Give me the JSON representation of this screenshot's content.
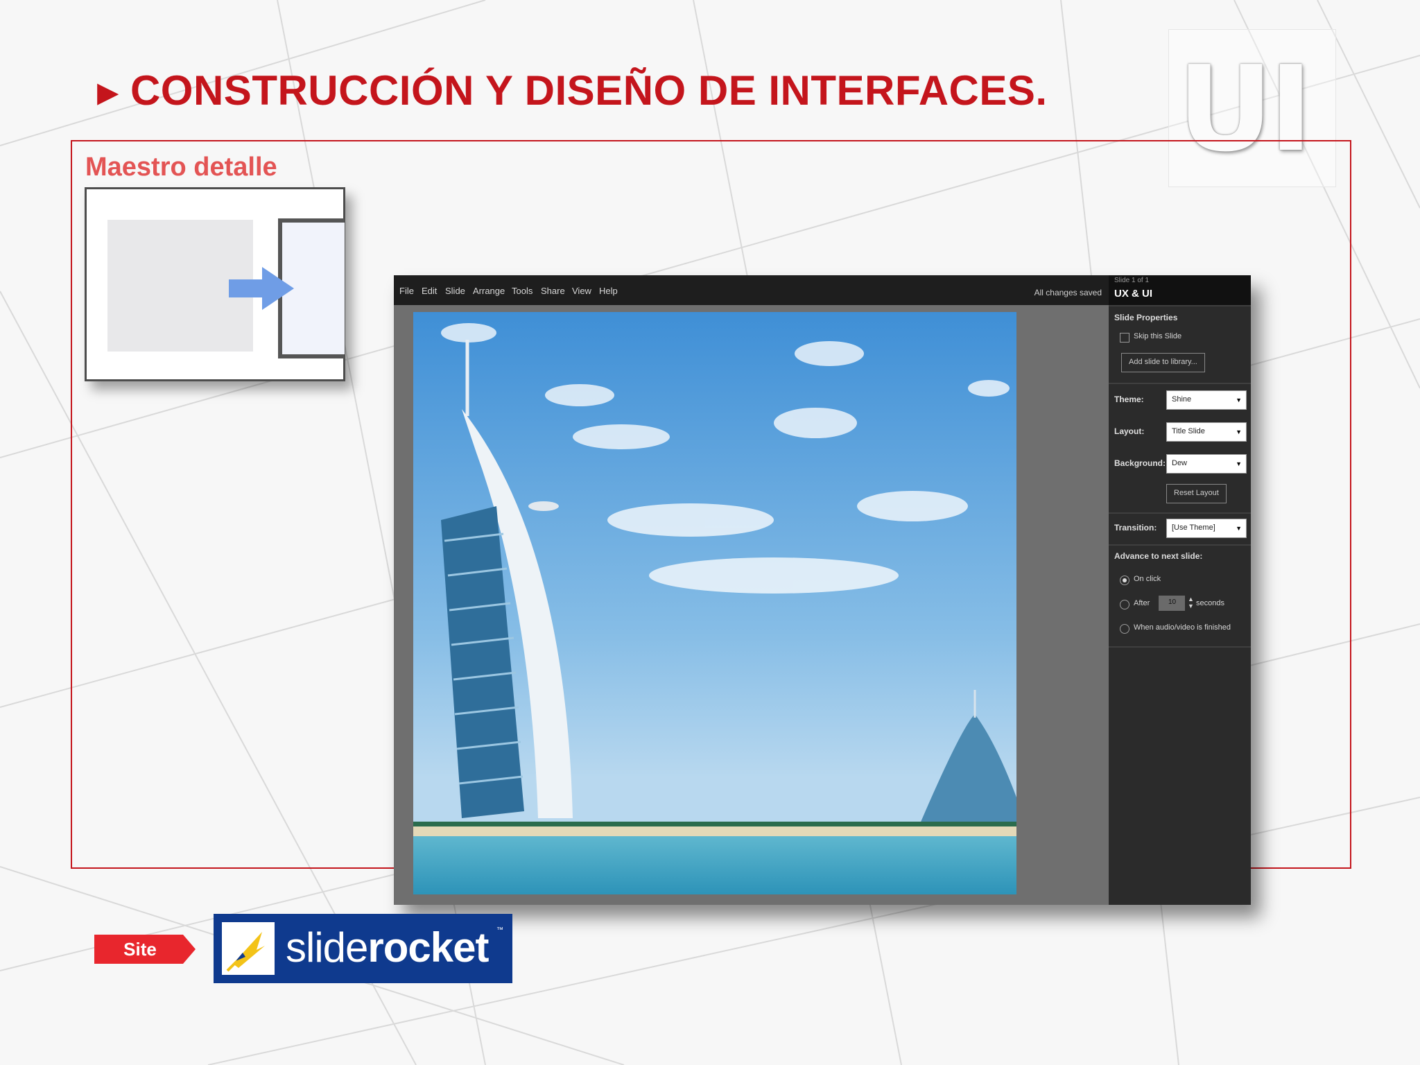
{
  "slide": {
    "title_arrow": "►",
    "title": "CONSTRUCCIÓN Y DISEÑO DE INTERFACES.",
    "logo_text": "UI",
    "subtitle": "Maestro detalle",
    "site_label": "Site",
    "accent_color": "#c4151c"
  },
  "screenshot": {
    "menu": [
      "File",
      "Edit",
      "Slide",
      "Arrange",
      "Tools",
      "Share",
      "View",
      "Help"
    ],
    "save_status": "All changes saved",
    "panel": {
      "slide_counter": "Slide 1 of 1",
      "presentation_title": "UX & UI",
      "section_title": "Slide Properties",
      "skip_label": "Skip this Slide",
      "add_to_library": "Add slide to library...",
      "theme_label": "Theme:",
      "theme_value": "Shine",
      "layout_label": "Layout:",
      "layout_value": "Title Slide",
      "background_label": "Background:",
      "background_value": "Dew",
      "reset_layout": "Reset Layout",
      "transition_label": "Transition:",
      "transition_value": "[Use Theme]",
      "advance_title": "Advance to next slide:",
      "opt_click": "On click",
      "opt_after": "After",
      "after_value": "10",
      "seconds": "seconds",
      "opt_media": "When audio/video is finished"
    }
  },
  "brand": {
    "logo_prefix": "slide",
    "logo_suffix": "rocket",
    "trademark": "™",
    "brand_color": "#0f3a8e",
    "icon": "rocket-icon"
  }
}
